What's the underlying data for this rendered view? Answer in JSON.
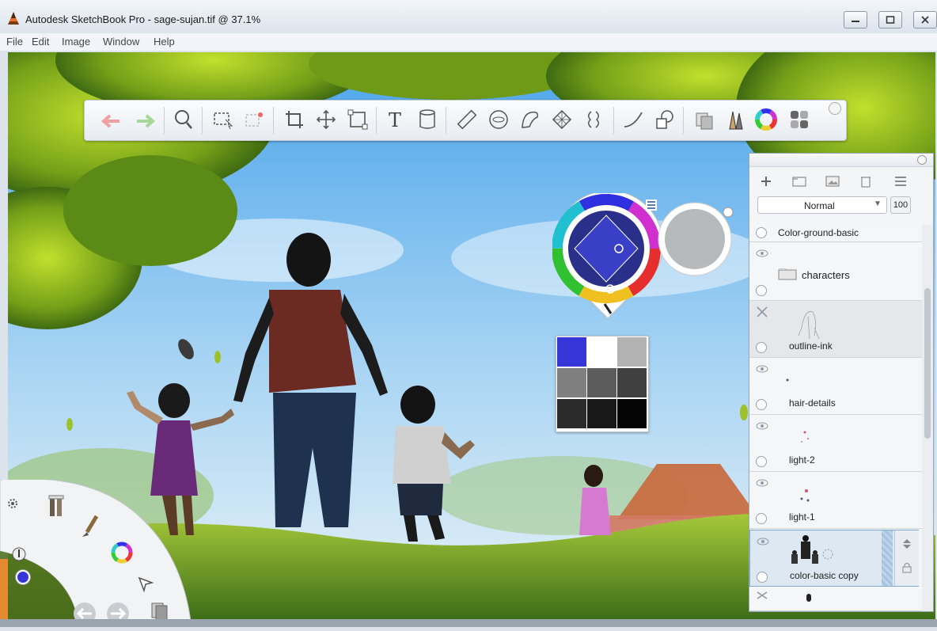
{
  "window": {
    "title": "Autodesk SketchBook Pro - sage-sujan.tif @ 37.1%",
    "controls": [
      "minimize",
      "maximize",
      "close"
    ]
  },
  "menu": [
    "File",
    "Edit",
    "Image",
    "Window",
    "Help"
  ],
  "toolbar": {
    "tools": [
      "undo-icon",
      "redo-icon",
      "zoom-icon",
      "select-icon",
      "lasso-select-icon",
      "crop-icon",
      "move-icon",
      "transform-icon",
      "text-icon",
      "fill-icon",
      "ruler-icon",
      "ellipse-guide-icon",
      "french-curve-icon",
      "perspective-icon",
      "symmetry-icon",
      "stroke-icon",
      "shape-icon",
      "copy-paste-icon",
      "brush-library-icon",
      "color-wheel-icon",
      "palette-icon"
    ]
  },
  "layers": {
    "blend_mode": "Normal",
    "opacity": "100",
    "items": [
      {
        "name": "Color-ground-basic",
        "eye": false
      },
      {
        "name": "characters",
        "eye": true,
        "type": "group"
      },
      {
        "name": "outline-ink",
        "eye": false,
        "hidden": true
      },
      {
        "name": "hair-details",
        "eye": true
      },
      {
        "name": "light-2",
        "eye": true
      },
      {
        "name": "light-1",
        "eye": true
      },
      {
        "name": "color-basic copy",
        "eye": true,
        "selected": true
      }
    ]
  },
  "colors": {
    "current": "#3535d8",
    "palette": [
      "#3535d8",
      "#ffffff",
      "#b3b3b3",
      "#7f7f7f",
      "#5c5c5c",
      "#404040",
      "#2a2a2a",
      "#181818",
      "#050505"
    ],
    "accent": "#e58a30"
  }
}
